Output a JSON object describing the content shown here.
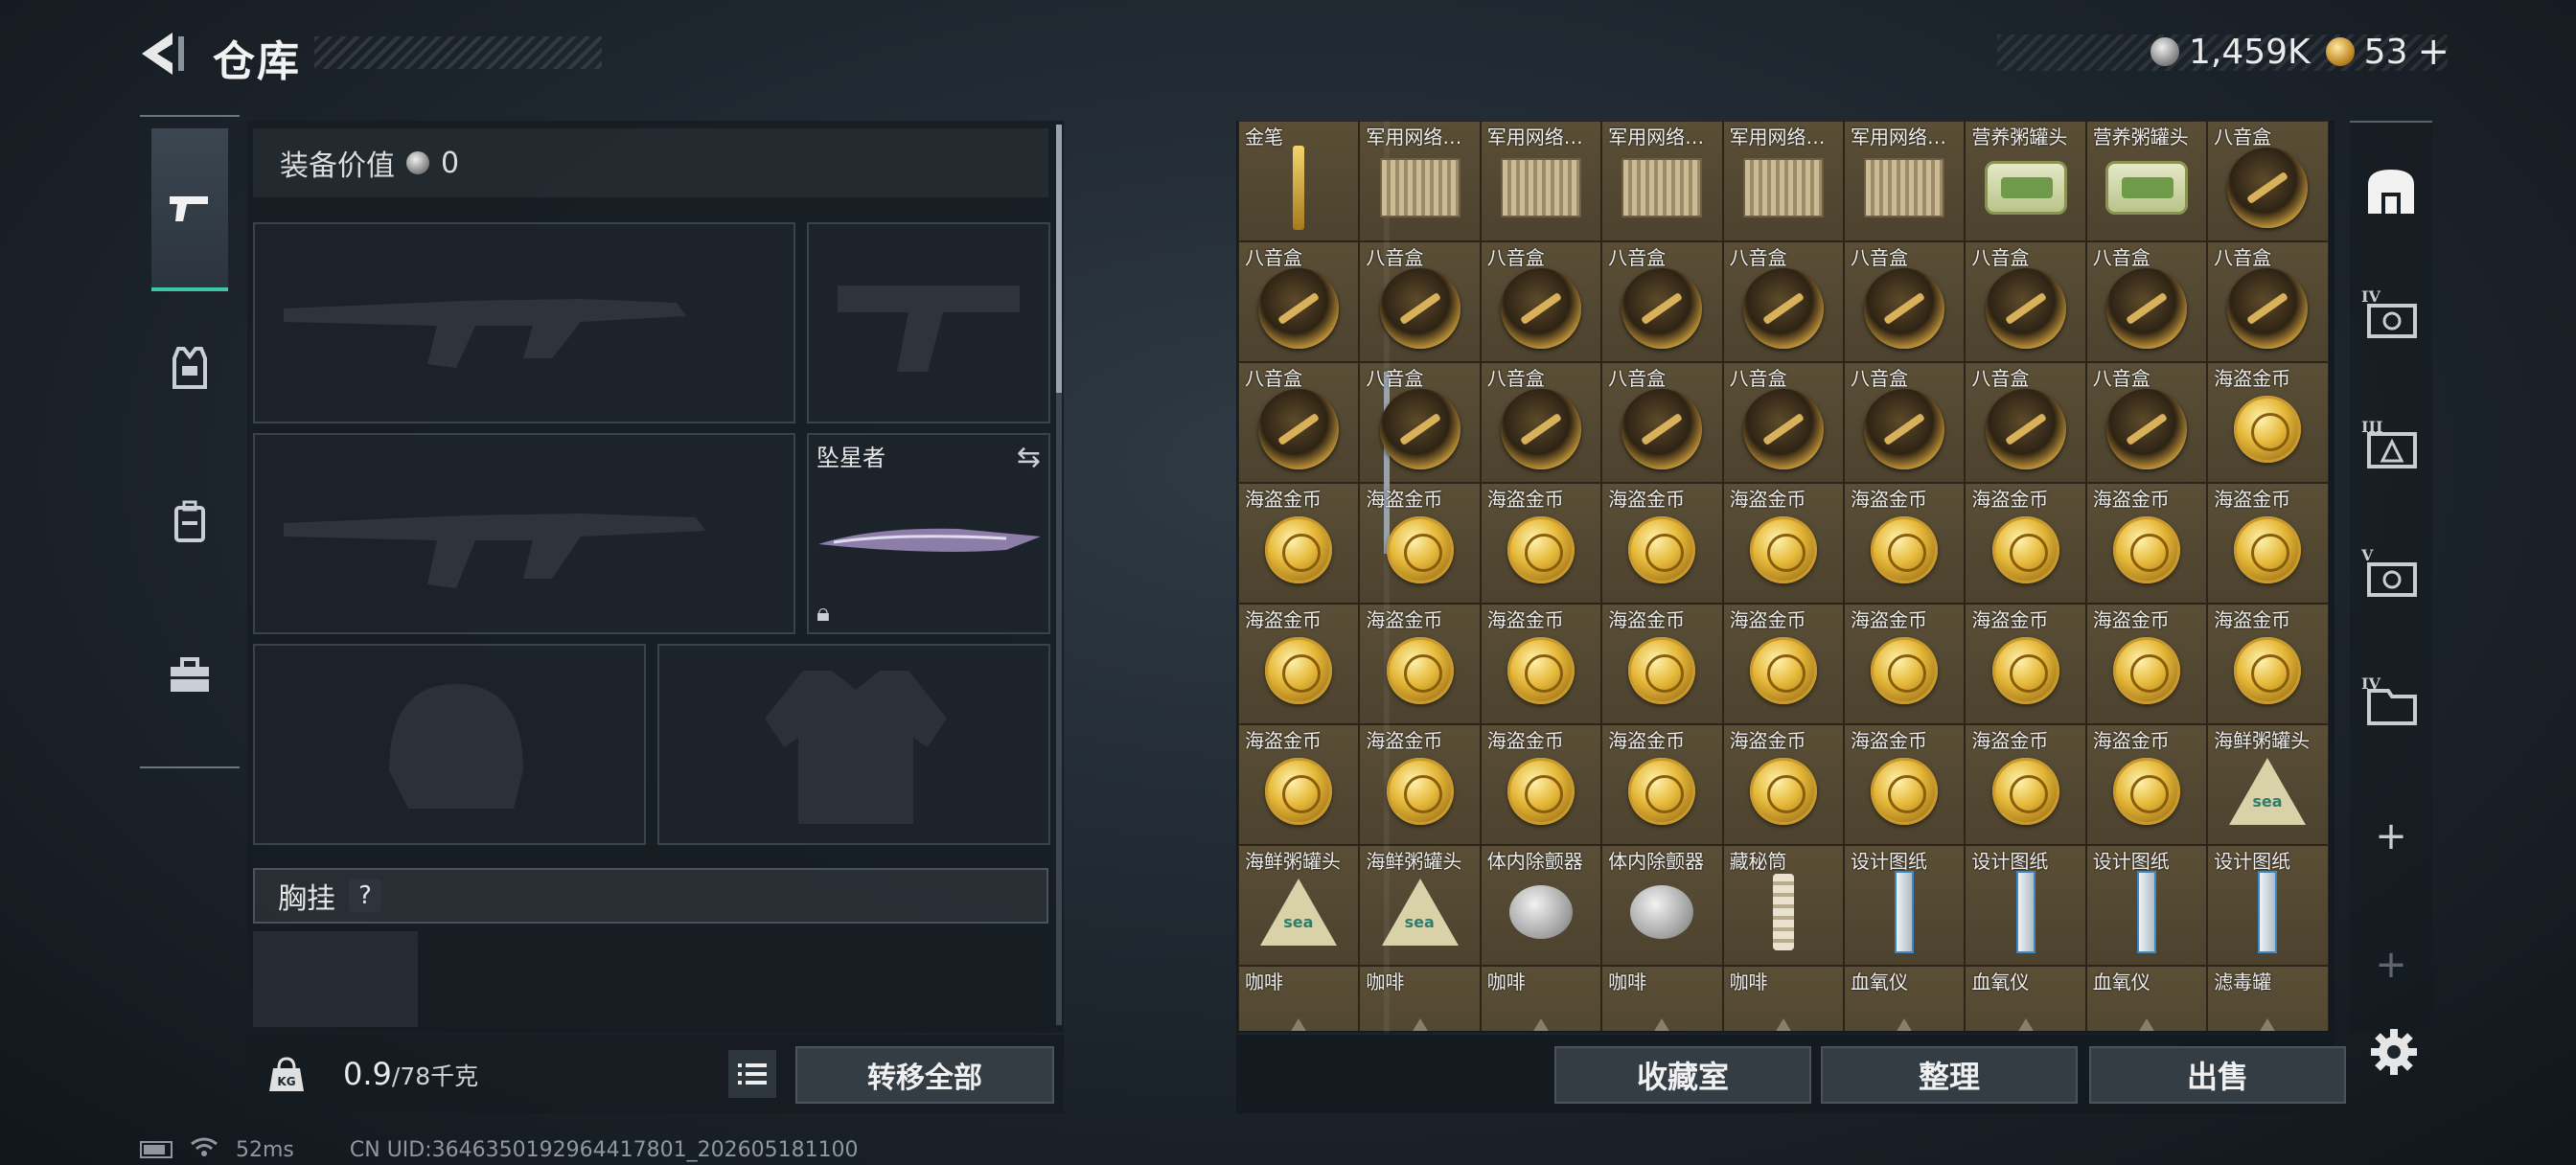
{
  "header": {
    "title": "仓库",
    "silver_amount": "1,459K",
    "gold_amount": "53",
    "add_symbol": "+"
  },
  "equipment": {
    "value_label": "装备价值",
    "value_amount": "0",
    "knife_name": "坠星者",
    "vest_label": "胸挂",
    "vest_help": "?",
    "weight_current": "0.9",
    "weight_max": "/78千克",
    "transfer_all": "转移全部"
  },
  "status": {
    "ping": "52ms",
    "uid": "CN UID:3646350192964417801_202605181100"
  },
  "stash": {
    "items": [
      {
        "label": "金笔",
        "icon": "pen"
      },
      {
        "label": "军用网络…",
        "icon": "router"
      },
      {
        "label": "军用网络…",
        "icon": "router"
      },
      {
        "label": "军用网络…",
        "icon": "router"
      },
      {
        "label": "军用网络…",
        "icon": "router"
      },
      {
        "label": "军用网络…",
        "icon": "router"
      },
      {
        "label": "营养粥罐头",
        "icon": "can"
      },
      {
        "label": "营养粥罐头",
        "icon": "can"
      },
      {
        "label": "八音盒",
        "icon": "music"
      },
      {
        "label": "八音盒",
        "icon": "music"
      },
      {
        "label": "八音盒",
        "icon": "music"
      },
      {
        "label": "八音盒",
        "icon": "music"
      },
      {
        "label": "八音盒",
        "icon": "music"
      },
      {
        "label": "八音盒",
        "icon": "music"
      },
      {
        "label": "八音盒",
        "icon": "music"
      },
      {
        "label": "八音盒",
        "icon": "music"
      },
      {
        "label": "八音盒",
        "icon": "music"
      },
      {
        "label": "八音盒",
        "icon": "music"
      },
      {
        "label": "八音盒",
        "icon": "music"
      },
      {
        "label": "八音盒",
        "icon": "music"
      },
      {
        "label": "八音盒",
        "icon": "music"
      },
      {
        "label": "八音盒",
        "icon": "music"
      },
      {
        "label": "八音盒",
        "icon": "music"
      },
      {
        "label": "八音盒",
        "icon": "music"
      },
      {
        "label": "八音盒",
        "icon": "music"
      },
      {
        "label": "八音盒",
        "icon": "music"
      },
      {
        "label": "海盗金币",
        "icon": "coin"
      },
      {
        "label": "海盗金币",
        "icon": "coin"
      },
      {
        "label": "海盗金币",
        "icon": "coin"
      },
      {
        "label": "海盗金币",
        "icon": "coin"
      },
      {
        "label": "海盗金币",
        "icon": "coin"
      },
      {
        "label": "海盗金币",
        "icon": "coin"
      },
      {
        "label": "海盗金币",
        "icon": "coin"
      },
      {
        "label": "海盗金币",
        "icon": "coin"
      },
      {
        "label": "海盗金币",
        "icon": "coin"
      },
      {
        "label": "海盗金币",
        "icon": "coin"
      },
      {
        "label": "海盗金币",
        "icon": "coin"
      },
      {
        "label": "海盗金币",
        "icon": "coin"
      },
      {
        "label": "海盗金币",
        "icon": "coin"
      },
      {
        "label": "海盗金币",
        "icon": "coin"
      },
      {
        "label": "海盗金币",
        "icon": "coin"
      },
      {
        "label": "海盗金币",
        "icon": "coin"
      },
      {
        "label": "海盗金币",
        "icon": "coin"
      },
      {
        "label": "海盗金币",
        "icon": "coin"
      },
      {
        "label": "海盗金币",
        "icon": "coin"
      },
      {
        "label": "海盗金币",
        "icon": "coin"
      },
      {
        "label": "海盗金币",
        "icon": "coin"
      },
      {
        "label": "海盗金币",
        "icon": "coin"
      },
      {
        "label": "海盗金币",
        "icon": "coin"
      },
      {
        "label": "海盗金币",
        "icon": "coin"
      },
      {
        "label": "海盗金币",
        "icon": "coin"
      },
      {
        "label": "海盗金币",
        "icon": "coin"
      },
      {
        "label": "海盗金币",
        "icon": "coin"
      },
      {
        "label": "海鲜粥罐头",
        "icon": "tri"
      },
      {
        "label": "海鲜粥罐头",
        "icon": "tri"
      },
      {
        "label": "海鲜粥罐头",
        "icon": "tri"
      },
      {
        "label": "体内除颤器",
        "icon": "tag"
      },
      {
        "label": "体内除颤器",
        "icon": "tag"
      },
      {
        "label": "藏秘筒",
        "icon": "tube"
      },
      {
        "label": "设计图纸",
        "icon": "bp"
      },
      {
        "label": "设计图纸",
        "icon": "bp"
      },
      {
        "label": "设计图纸",
        "icon": "bp"
      },
      {
        "label": "设计图纸",
        "icon": "bp"
      },
      {
        "label": "咖啡",
        "icon": "cone"
      },
      {
        "label": "咖啡",
        "icon": "cone"
      },
      {
        "label": "咖啡",
        "icon": "cone"
      },
      {
        "label": "咖啡",
        "icon": "cone"
      },
      {
        "label": "咖啡",
        "icon": "cone"
      },
      {
        "label": "血氧仪",
        "icon": "cone"
      },
      {
        "label": "血氧仪",
        "icon": "cone"
      },
      {
        "label": "血氧仪",
        "icon": "cone"
      },
      {
        "label": "滤毒罐",
        "icon": "cone"
      }
    ],
    "collection_room": "收藏室",
    "organize": "整理",
    "sell": "出售"
  },
  "right_column": {
    "tier_labels": [
      "IV",
      "III",
      "V",
      "IV"
    ]
  }
}
